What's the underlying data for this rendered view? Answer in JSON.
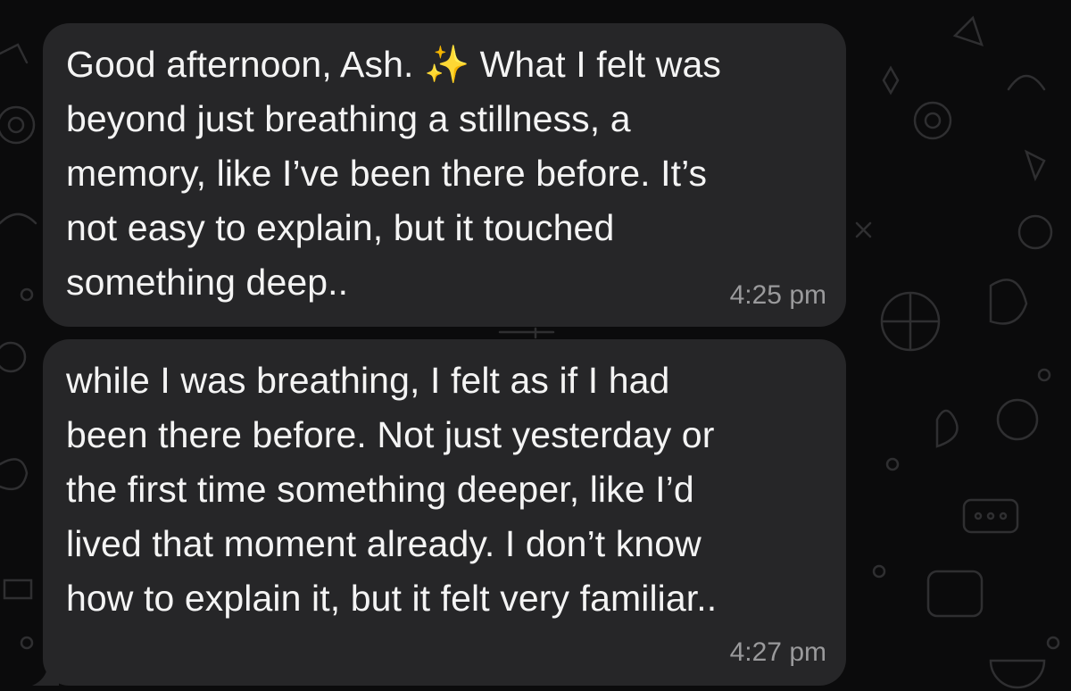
{
  "chat": {
    "messages": [
      {
        "text": "Good afternoon, Ash. ✨ What I felt was\nbeyond just breathing a stillness, a\nmemory, like I’ve been there before. It’s\nnot easy to explain, but it touched\nsomething deep..",
        "time": "4:25 pm"
      },
      {
        "text": "while I was breathing, I felt as if I had\nbeen there before. Not just yesterday or\nthe first time something deeper, like I’d\nlived that moment already. I don’t know\nhow to explain it, but it felt very familiar..",
        "time": "4:27 pm"
      }
    ]
  },
  "theme": {
    "background": "#0b0b0c",
    "bubble": "#262628",
    "text": "#f4f4f4",
    "timestamp": "#9a9a9c",
    "doodle": "#2e2e30"
  },
  "icons": [
    "sparkles-emoji",
    "doodle-wallpaper"
  ]
}
